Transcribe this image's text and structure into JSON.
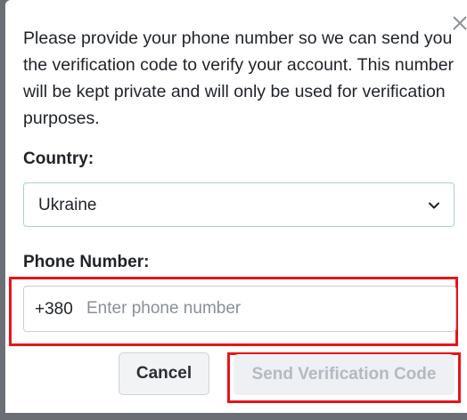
{
  "dialog": {
    "message": "Please provide your phone number so we can send you the verification code to verify your account. This number will be kept private and will only be used for verification purposes.",
    "country": {
      "label": "Country:",
      "selected": "Ukraine"
    },
    "phone": {
      "label": "Phone Number:",
      "prefix": "+380",
      "value": "",
      "placeholder": "Enter phone number"
    },
    "buttons": {
      "cancel": "Cancel",
      "send": "Send Verification Code"
    },
    "colors": {
      "highlight": "#e8141b",
      "select_border": "#a9cfcf",
      "disabled_text": "#b3bac2"
    },
    "icons": {
      "close": "close-icon",
      "dropdown": "chevron-down-icon"
    }
  }
}
